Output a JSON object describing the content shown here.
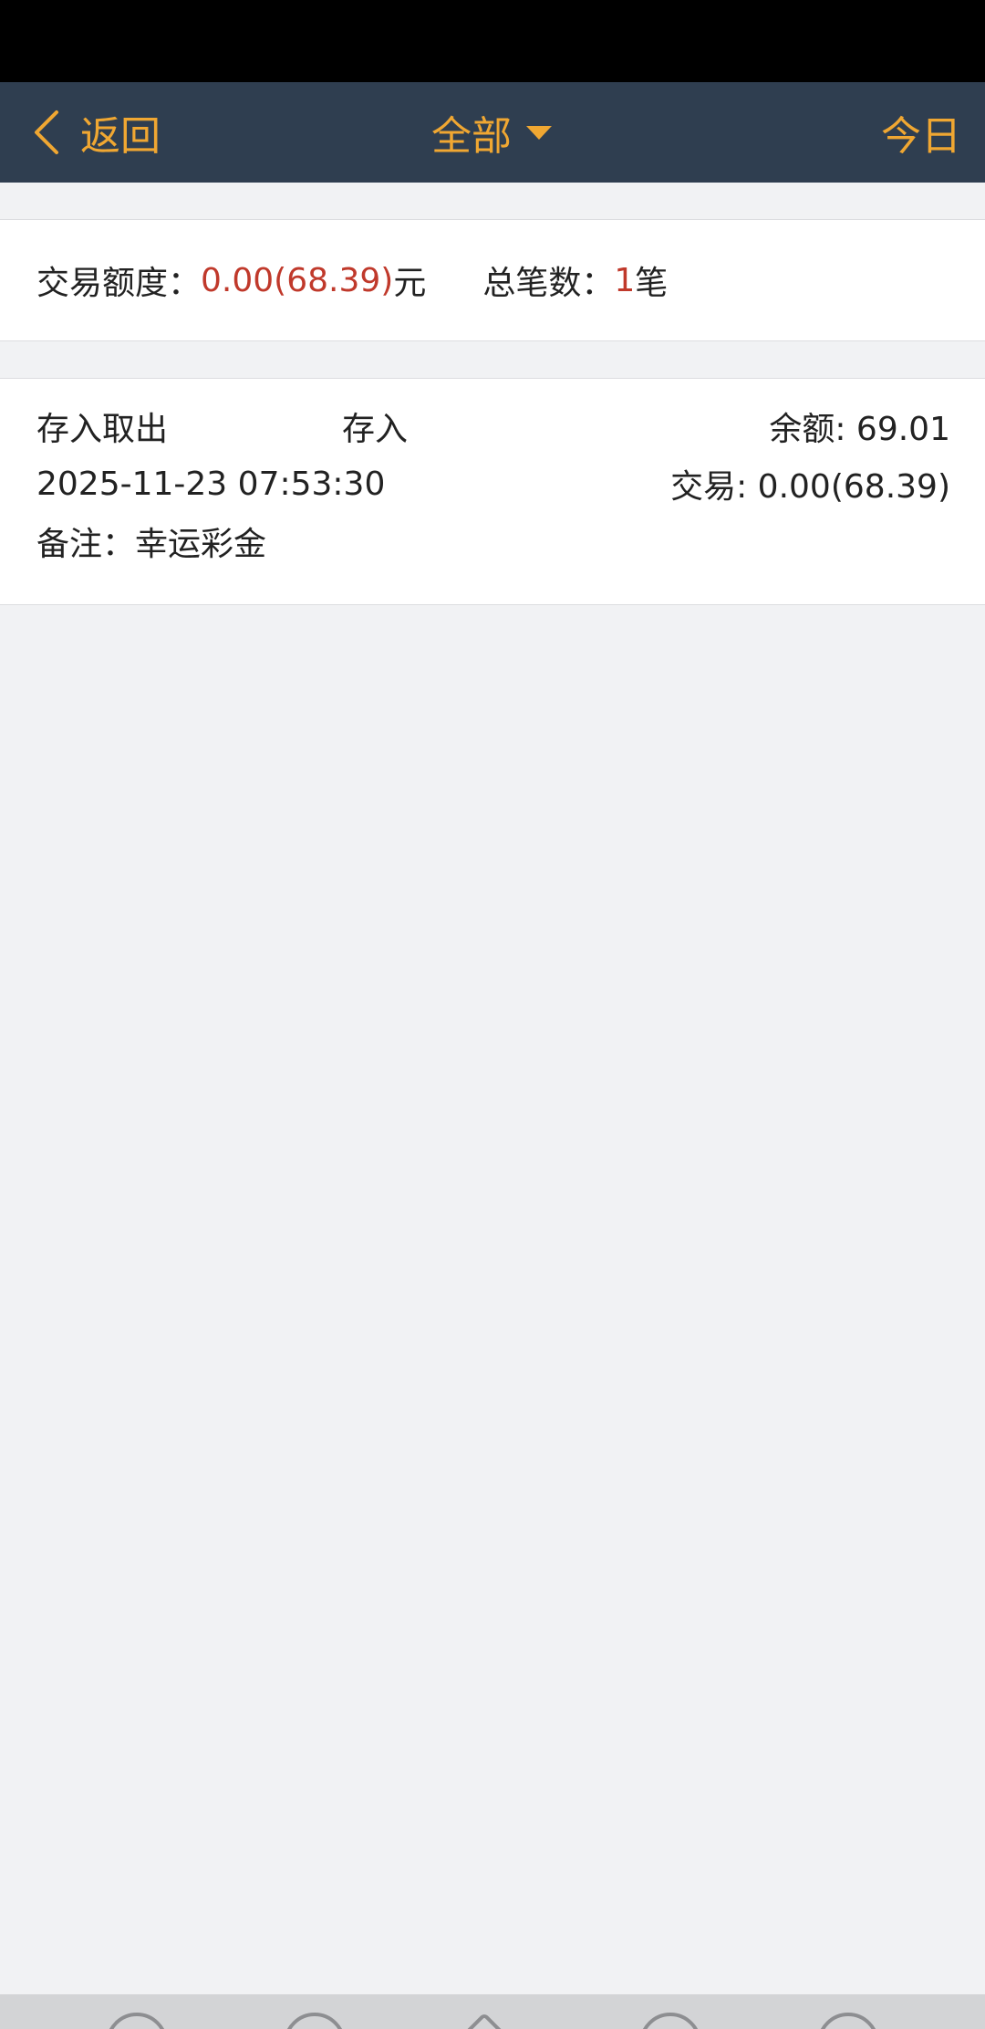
{
  "nav": {
    "back_label": "返回",
    "title": "全部",
    "today_label": "今日",
    "accent_color": "#f0a732",
    "background_color": "#2f3e50"
  },
  "summary": {
    "amount_label": "交易额度：",
    "amount_value": "0.00(68.39)",
    "amount_unit": "元",
    "count_label": "总笔数：",
    "count_value": "1",
    "count_unit": "笔",
    "highlight_color": "#c0392b"
  },
  "records": [
    {
      "category": "存入取出",
      "type": "存入",
      "balance": "余额: 69.01",
      "datetime": "2025-11-23 07:53:30",
      "transaction": "交易: 0.00(68.39)",
      "note": "备注：幸运彩金"
    }
  ],
  "bottom_tabs": [
    "tab-icon-1",
    "tab-icon-2",
    "home-icon",
    "refresh-icon",
    "tab-icon-5"
  ]
}
